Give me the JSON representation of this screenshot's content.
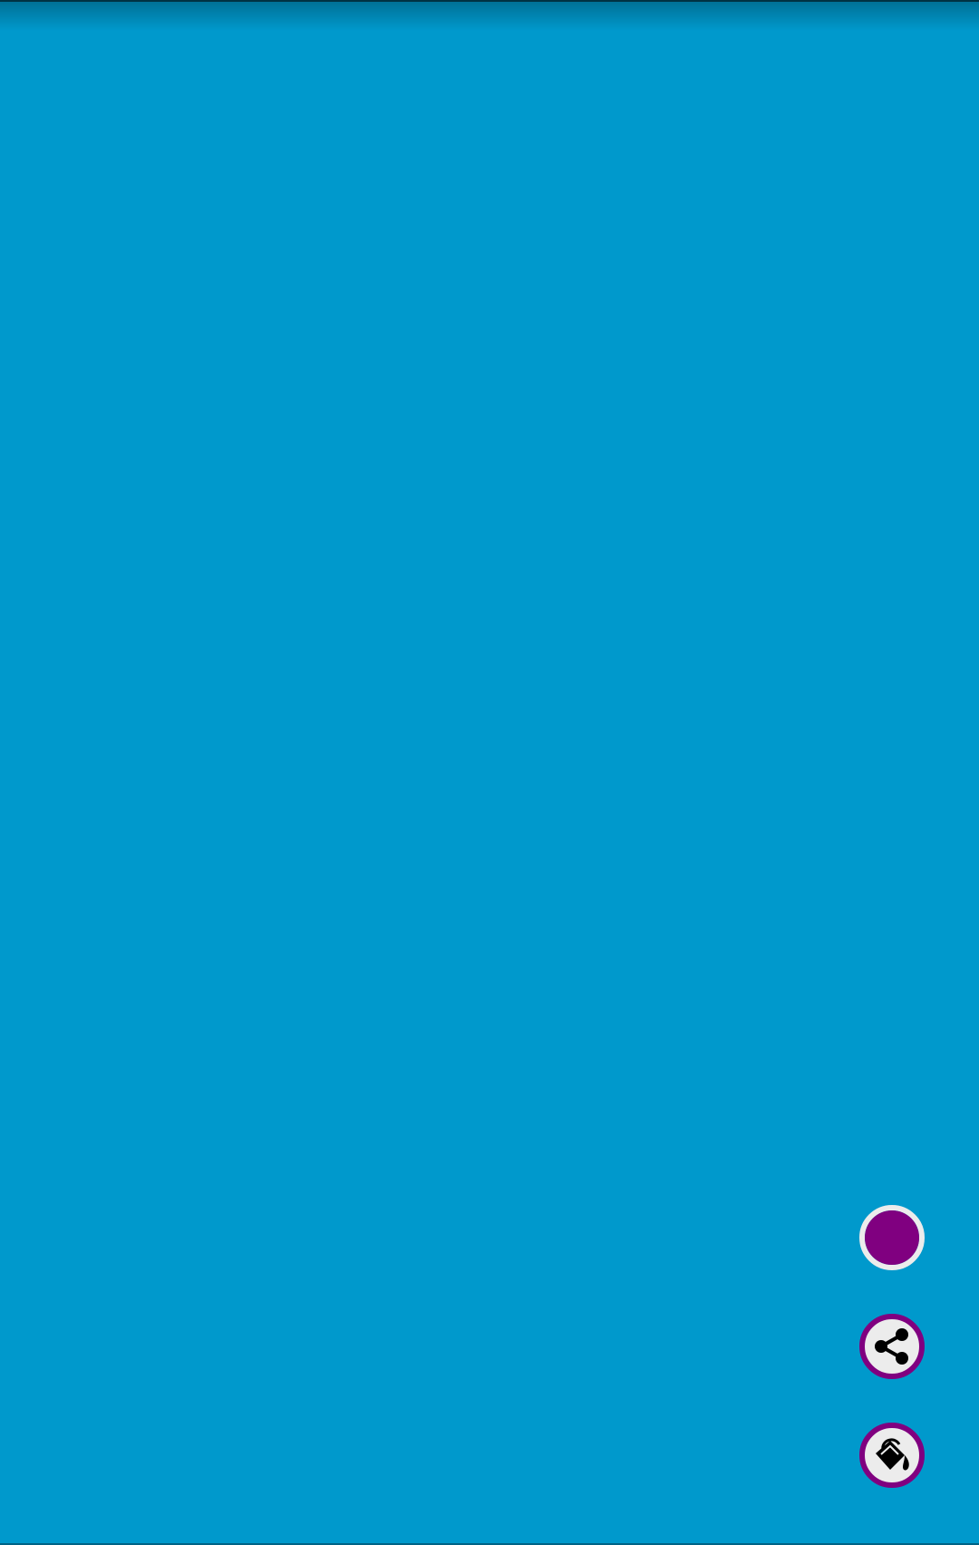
{
  "screen": {
    "background_color": "#0099CC"
  },
  "fabs": [
    {
      "name": "current-color-button",
      "icon": "color-swatch-icon",
      "fill_color": "#800080",
      "ring_color": "#ECECEC"
    },
    {
      "name": "share-button",
      "icon": "share-icon",
      "ring_color": "#800080",
      "fill_color": "#ECECEC"
    },
    {
      "name": "paint-bucket-button",
      "icon": "paint-bucket-icon",
      "ring_color": "#800080",
      "fill_color": "#ECECEC"
    }
  ]
}
